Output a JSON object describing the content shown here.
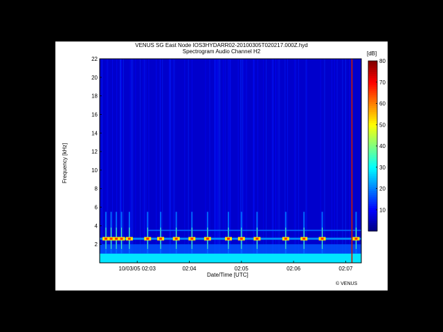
{
  "chart_data": {
    "type": "heatmap",
    "title_line1": "VENUS   SG   East Node   IOS3HYDARR02-20100305T020217.000Z.hyd",
    "title_line2": "Spectrogram Audio Channel H2",
    "xlabel": "Date/Time [UTC]",
    "ylabel": "Frequency [kHz]",
    "x_ticks": [
      "10/03/05 02:03",
      "02:04",
      "02:05",
      "02:06",
      "02:07"
    ],
    "x_tick_minutes": [
      3,
      4,
      5,
      6,
      7
    ],
    "xlim_minutes": [
      2.28,
      7.3
    ],
    "y_ticks": [
      2,
      4,
      6,
      8,
      10,
      12,
      14,
      16,
      18,
      20,
      22
    ],
    "ylim": [
      0,
      22
    ],
    "colorbar": {
      "label": "[dB]",
      "ticks": [
        10,
        20,
        30,
        40,
        50,
        60,
        70,
        80
      ],
      "range": [
        0,
        80
      ],
      "colormap": "jet"
    },
    "features": {
      "background_level_db": 6,
      "low_frequency_noise_band_khz": [
        0,
        1
      ],
      "tonal_band_khz": 2.6,
      "upper_tonal_band_khz": 3.5,
      "click_train_minutes": [
        2.4,
        2.5,
        2.6,
        2.7,
        2.85,
        3.2,
        3.45,
        3.75,
        4.05,
        4.35,
        4.75,
        5.0,
        5.3,
        5.85,
        6.2,
        6.55,
        7.2
      ],
      "marker_minute": 7.12,
      "marker_color": "#cc1b00"
    },
    "grid": false
  },
  "copyright": "© VENUS"
}
